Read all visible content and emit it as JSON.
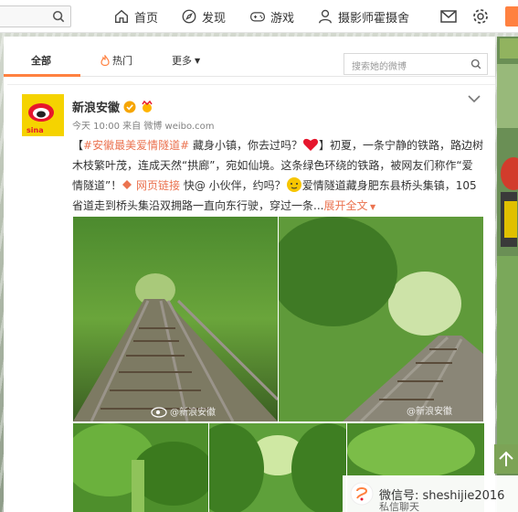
{
  "topnav": {
    "home": "首页",
    "discover": "发现",
    "games": "游戏",
    "user": "摄影师霍摄舍"
  },
  "tabs": {
    "all": "全部",
    "hot": "热门",
    "more": "更多"
  },
  "feed_search": {
    "placeholder": "搜索她的微博"
  },
  "post": {
    "author": "新浪安徽",
    "meta": "今天 10:00 来自 微博 weibo.com",
    "hashtag": "#安徽最美爱情隧道#",
    "text_1": " 藏身小镇，你去过吗？",
    "text_2": "】初夏，一条宁静的铁路，路边树木枝繁叶茂，连成天然“拱廊”，宛如仙境。这条绿色环绕的铁路，被网友们称作“爱情隧道”！",
    "link": " 网页链接",
    "text_3": " 快@ 小伙伴，约吗？",
    "text_4": "爱情隧道藏身肥东县桥头集镇，105省道走到桥头集沿双拥路一直向东行驶，穿过一条...",
    "more": "展开全文",
    "watermark_1": "@新浪安徽",
    "watermark_2": "@新浪安徽"
  },
  "bottom_badge": {
    "text": "微信号: sheshijie2016",
    "sub": "私信聊天"
  },
  "colors": {
    "accent": "#ff8140",
    "link": "#eb7350",
    "verified": "#f6a500"
  }
}
